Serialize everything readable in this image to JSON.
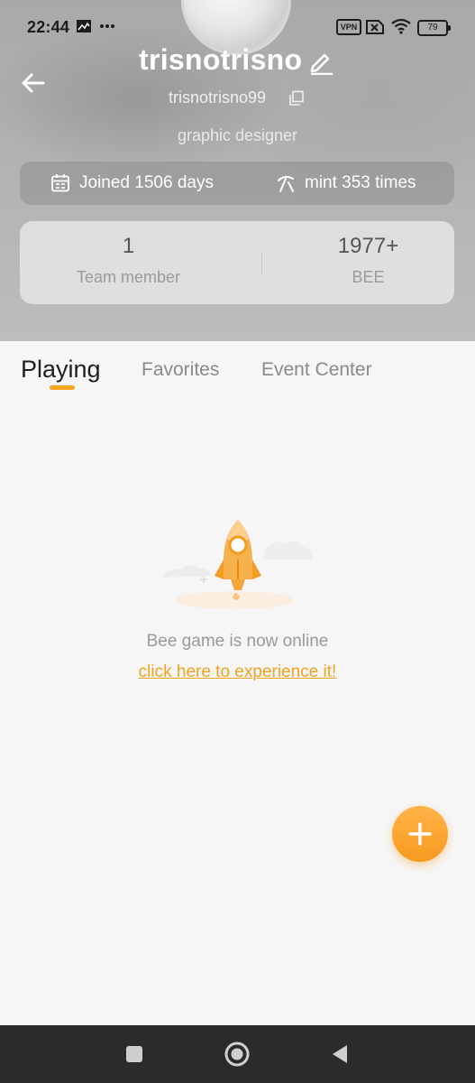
{
  "status_bar": {
    "time": "22:44",
    "vpn_label": "VPN",
    "battery_level": "79"
  },
  "profile": {
    "username": "trisnotrisno",
    "handle": "trisnotrisno99",
    "bio": "graphic designer",
    "joined_text": "Joined 1506 days",
    "mint_text": "mint 353 times"
  },
  "stats": [
    {
      "value": "1",
      "label": "Team member"
    },
    {
      "value": "1977+",
      "label": "BEE"
    }
  ],
  "tabs": [
    {
      "label": "Playing",
      "active": true
    },
    {
      "label": "Favorites",
      "active": false
    },
    {
      "label": "Event Center",
      "active": false
    }
  ],
  "empty_state": {
    "message": "Bee game is now online",
    "link_text": "click here to experience it!"
  },
  "colors": {
    "accent": "#f5a623",
    "link": "#f0a31f",
    "fab_gradient_top": "#ffb347",
    "fab_gradient_bottom": "#f79a1f"
  },
  "icons": {
    "back": "arrow-left-icon",
    "edit": "pencil-icon",
    "copy": "copy-icon",
    "joined": "calendar-icon",
    "mint": "pickaxe-icon",
    "fab": "plus-icon",
    "nav_recents": "square-icon",
    "nav_home": "circle-icon",
    "nav_back": "triangle-back-icon"
  }
}
